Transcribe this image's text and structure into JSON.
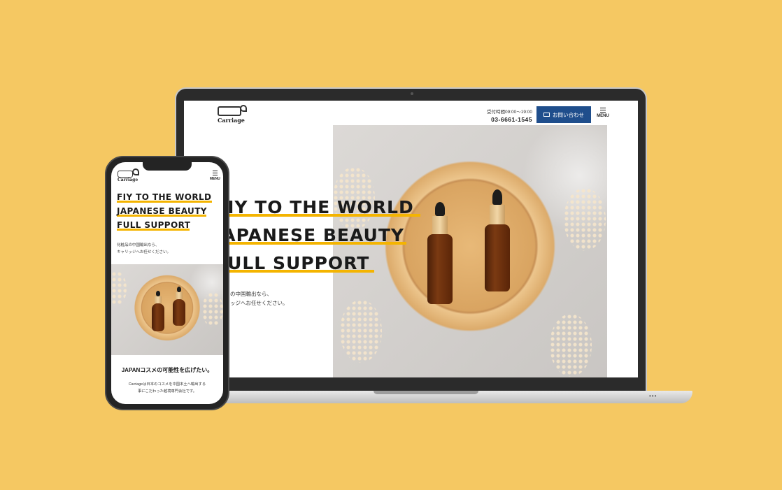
{
  "site": {
    "logo_text": "Carriage",
    "hours": "受付時間09:00〜19:00",
    "phone": "03-6661-1545",
    "contact_label": "お問い合わせ",
    "menu_label": "MENU"
  },
  "hero": {
    "lines": [
      "FIY TO THE WORLD",
      "JAPANESE BEAUTY",
      "FULL SUPPORT"
    ],
    "desktop_lines": [
      "FIY TO THE WORLD",
      "JAPANESE BEAUTY",
      "FULL SUPPORT"
    ],
    "sub_line1": "化粧品の中国輸出なら、",
    "sub_line2": "キャリッジへお任せください。",
    "desktop_sub_line1": "の中国輸出なら、",
    "desktop_sub_line2": "ッジへお任せください。"
  },
  "phone_section": {
    "heading": "JAPANコスメの可能性を広げたい。",
    "body_line1": "Carriageは日本のコスメを中国本土へ輸出する",
    "body_line2": "事にこだわった越境専門会社です。"
  },
  "colors": {
    "background": "#F5C862",
    "accent": "#f4b400",
    "button": "#1f4e8c"
  },
  "icons": [
    "carriage-logo-icon",
    "mail-icon",
    "menu-icon",
    "camera-icon"
  ]
}
